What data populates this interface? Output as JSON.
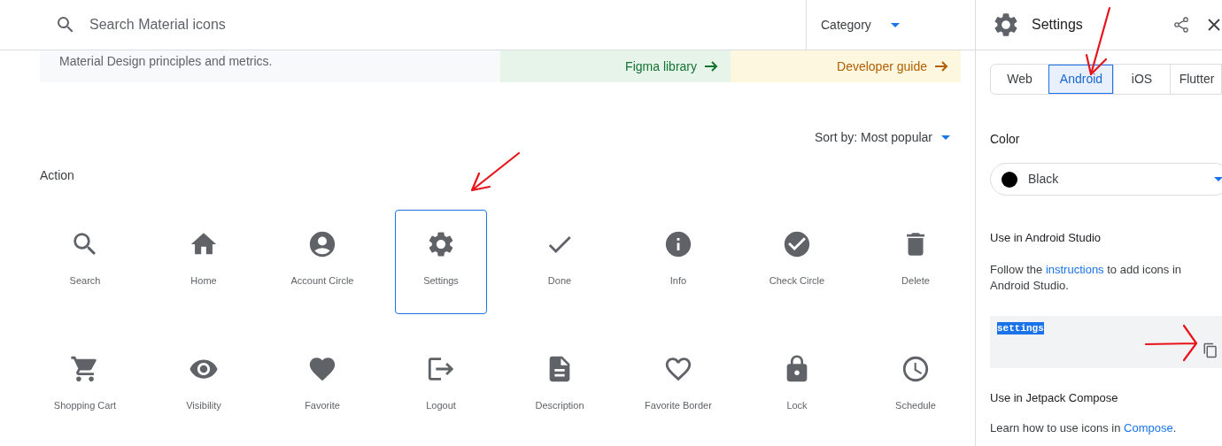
{
  "search": {
    "placeholder": "Search Material icons"
  },
  "category": {
    "label": "Category"
  },
  "banner": {
    "text": "Material Design principles and metrics.",
    "links": [
      {
        "kind": "figma",
        "label": "Figma library"
      },
      {
        "kind": "developer",
        "label": "Developer guide"
      }
    ]
  },
  "sort": {
    "label": "Sort by: Most popular"
  },
  "section": {
    "title": "Action"
  },
  "icons": [
    {
      "kind": "search",
      "label": "Search",
      "selected": false
    },
    {
      "kind": "home",
      "label": "Home",
      "selected": false
    },
    {
      "kind": "account",
      "label": "Account Circle",
      "selected": false
    },
    {
      "kind": "settings",
      "label": "Settings",
      "selected": true
    },
    {
      "kind": "done",
      "label": "Done",
      "selected": false
    },
    {
      "kind": "info",
      "label": "Info",
      "selected": false
    },
    {
      "kind": "check",
      "label": "Check Circle",
      "selected": false
    },
    {
      "kind": "delete",
      "label": "Delete",
      "selected": false
    },
    {
      "kind": "cart",
      "label": "Shopping Cart",
      "selected": false
    },
    {
      "kind": "eye",
      "label": "Visibility",
      "selected": false
    },
    {
      "kind": "heart",
      "label": "Favorite",
      "selected": false
    },
    {
      "kind": "logout",
      "label": "Logout",
      "selected": false
    },
    {
      "kind": "document",
      "label": "Description",
      "selected": false
    },
    {
      "kind": "heart_outline",
      "label": "Favorite Border",
      "selected": false
    },
    {
      "kind": "lock",
      "label": "Lock",
      "selected": false
    },
    {
      "kind": "clock",
      "label": "Schedule",
      "selected": false
    }
  ],
  "panel": {
    "title": "Settings",
    "tabs": [
      {
        "label": "Web",
        "selected": false
      },
      {
        "label": "Android",
        "selected": true
      },
      {
        "label": "iOS",
        "selected": false
      },
      {
        "label": "Flutter",
        "selected": false
      }
    ],
    "color_label": "Color",
    "color_value": "Black",
    "studio_heading": "Use in Android Studio",
    "studio_text": [
      {
        "text": "Follow the ",
        "link": false
      },
      {
        "text": "instructions",
        "link": true
      },
      {
        "text": " to add icons in Android Studio.",
        "link": false
      }
    ],
    "code": {
      "text": "settings",
      "highlighted": true
    },
    "compose_heading": "Use in Jetpack Compose",
    "compose_text": [
      {
        "text": "Learn how to use icons in ",
        "link": false
      },
      {
        "text": "Compose",
        "link": true
      },
      {
        "text": ".",
        "link": false
      }
    ]
  }
}
